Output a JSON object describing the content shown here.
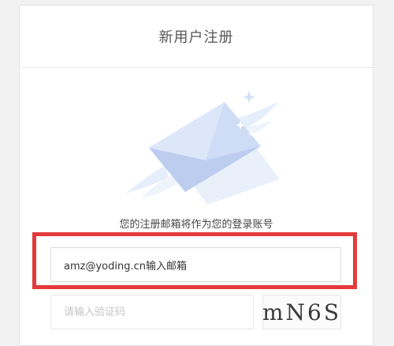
{
  "header": {
    "title": "新用户注册"
  },
  "illustration": {
    "icon": "winged-envelope"
  },
  "tip": "您的注册邮箱将作为您的登录账号",
  "form": {
    "email_value": "amz@yoding.cn输入邮箱",
    "code_placeholder": "请输入验证码",
    "captcha_text": "mN6S"
  },
  "colors": {
    "highlight": "#e23b3b",
    "envelope": "#cfdcf5"
  }
}
